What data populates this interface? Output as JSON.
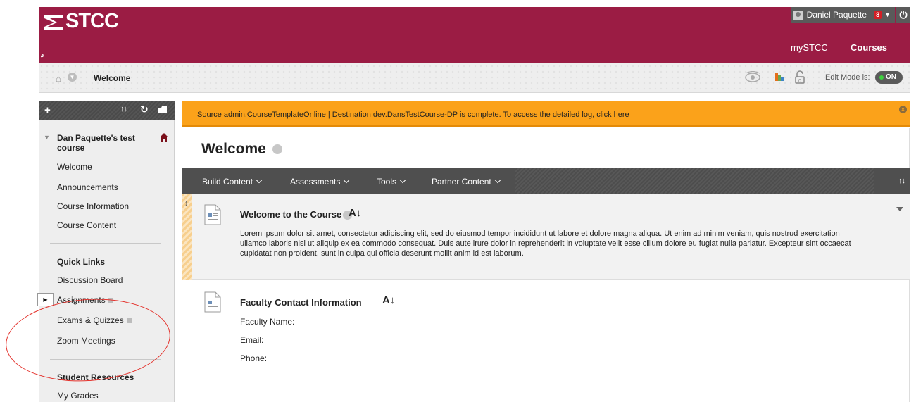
{
  "header": {
    "logo_text": "STCC",
    "user_name": "Daniel Paquette",
    "notification_count": "8",
    "nav": {
      "mystcc": "mySTCC",
      "courses": "Courses"
    },
    "brand_color": "#9b1c44"
  },
  "breadcrumb": {
    "title": "Welcome",
    "edit_mode_label": "Edit Mode is:",
    "edit_mode_state": "ON"
  },
  "sidebar": {
    "course_name": "Dan Paquette's test course",
    "items": [
      {
        "label": "Welcome"
      },
      {
        "label": "Announcements"
      },
      {
        "label": "Course Information"
      },
      {
        "label": "Course Content"
      }
    ],
    "quick_links_heading": "Quick Links",
    "quick_links": [
      {
        "label": "Discussion Board"
      },
      {
        "label": "Assignments"
      },
      {
        "label": "Exams & Quizzes"
      },
      {
        "label": "Zoom Meetings"
      }
    ],
    "student_resources_heading": "Student Resources",
    "student_resources": [
      {
        "label": "My Grades"
      }
    ]
  },
  "alert": {
    "message": "Source admin.CourseTemplateOnline | Destination dev.DansTestCourse-DP is complete. To access the detailed log, click here",
    "color": "#fba21a"
  },
  "main": {
    "page_title": "Welcome",
    "action_bar": [
      {
        "label": "Build Content"
      },
      {
        "label": "Assessments"
      },
      {
        "label": "Tools"
      },
      {
        "label": "Partner Content"
      }
    ],
    "items": [
      {
        "title": "Welcome to the Course",
        "body": "Lorem ipsum dolor sit amet, consectetur adipiscing elit, sed do eiusmod tempor incididunt ut labore et dolore magna aliqua. Ut enim ad minim veniam, quis nostrud exercitation ullamco laboris nisi ut aliquip ex ea commodo consequat. Duis aute irure dolor in reprehenderit in voluptate velit esse cillum dolore eu fugiat nulla pariatur. Excepteur sint occaecat cupidatat non proident, sunt in culpa qui officia deserunt mollit anim id est laborum."
      },
      {
        "title": "Faculty Contact Information",
        "fields": [
          "Faculty Name:",
          "Email:",
          "Phone:"
        ]
      }
    ]
  }
}
